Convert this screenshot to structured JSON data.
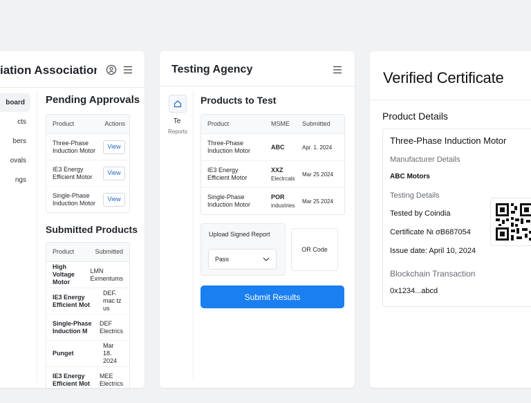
{
  "panel1": {
    "title": "iation Association",
    "nav": [
      {
        "label": "board",
        "active": true
      },
      {
        "label": "cts",
        "active": false
      },
      {
        "label": "bers",
        "active": false
      },
      {
        "label": "ovals",
        "active": false
      },
      {
        "label": "ngs",
        "active": false
      }
    ],
    "pending": {
      "title": "Pending Approvals",
      "headers": [
        "Product",
        "Actions"
      ],
      "view_label": "View",
      "rows": [
        [
          "Three-Phase",
          "Induction Motor"
        ],
        [
          "IE3 Energy",
          "Efficient Motor"
        ],
        [
          "Single-Phase",
          "Induction Motor"
        ]
      ]
    },
    "submitted": {
      "title": "Submitted Products",
      "headers": [
        "Product",
        "Submitted"
      ],
      "rows": [
        {
          "p1": "High Voltage",
          "p2": "Motor",
          "s1": "LMN",
          "s2": "Exmentums"
        },
        {
          "p1": "IE3 Energy",
          "p2": "Efficient Mot",
          "s1": "DEF.",
          "s2": "mac tz us"
        },
        {
          "p1": "Single-Phase",
          "p2": "Induction M",
          "s1": "DEF",
          "s2": "Electrics"
        },
        {
          "p1": "Punget",
          "p2": "",
          "s1": "Mar 18. 2024",
          "s2": ""
        },
        {
          "p1": "IE3 Energy",
          "p2": "Efficient Mot",
          "s1": "MEE",
          "s2": "Electrics"
        }
      ]
    }
  },
  "panel2": {
    "title": "Testing Agency",
    "side_te": "Te",
    "side_reports": "Reports",
    "products_title": "Products to Test",
    "headers": [
      "Product",
      "MSME",
      "Submitted"
    ],
    "rows": [
      {
        "p1": "Three-Phase",
        "p2": "Induction Motor",
        "m1": "ABC",
        "m2": "",
        "date": "Apr. 1. 2024"
      },
      {
        "p1": "IE3 Energy",
        "p2": "Efficient Motor",
        "m1": "XXZ",
        "m2": "Electrcals",
        "date": "Mar 25 2024"
      },
      {
        "p1": "Single-Phase",
        "p2": "Induction Motor",
        "m1": "POR",
        "m2": "industries",
        "date": "Mar 25 2024"
      }
    ],
    "upload_label": "Upload Signed Report",
    "select_value": "Pass",
    "qr_label": "OR Code",
    "submit_label": "Submit Results"
  },
  "panel3": {
    "title": "Verified Certificate",
    "product_details": "Product Details",
    "product_name": "Three-Phase Induction Motor",
    "manufacturer_label": "Manufacturer Details",
    "manufacturer_value": "ABC Motors",
    "testing_label": "Testing Details",
    "tested_by": "Tested by Coindia",
    "certificate": "Certificate Nι σB687054",
    "issue_date": "Issue date: April 10, 2024",
    "blockchain_label": "Blockchain Transaction",
    "blockchain_value": "0x1234...abcd"
  },
  "colors": {
    "accent": "#1a7ff0",
    "link": "#2468c5",
    "background": "#f1f2f4"
  },
  "icons": [
    "user-icon",
    "menu-icon",
    "home-icon",
    "chevron-down-icon",
    "qr-code-icon"
  ]
}
